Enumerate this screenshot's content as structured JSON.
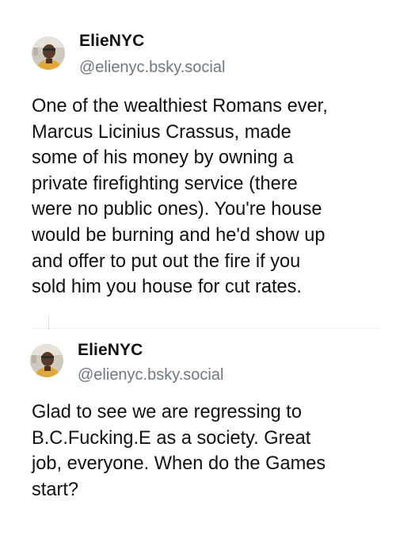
{
  "thread": {
    "posts": [
      {
        "author": {
          "display_name": "ElieNYC",
          "handle": "@elienyc.bsky.social",
          "avatar_icon": "avatar-photo-icon"
        },
        "text_lines": [
          "One of the wealthiest Romans ever,",
          "Marcus Licinius Crassus, made",
          "some of his money by owning a",
          "private firefighting service (there",
          "were no public ones). You're house",
          "would be burning and he'd show up",
          "and offer to put out the fire if you",
          "sold him you house for cut rates."
        ]
      },
      {
        "author": {
          "display_name": "ElieNYC",
          "handle": "@elienyc.bsky.social",
          "avatar_icon": "avatar-photo-icon"
        },
        "text_lines": [
          "Glad to see we are regressing to",
          "B.C.Fucking.E as a society. Great",
          "job, everyone. When do the Games",
          "start?"
        ]
      }
    ]
  },
  "colors": {
    "text": "#111111",
    "handle": "#6f7780",
    "divider": "#eceef1"
  }
}
